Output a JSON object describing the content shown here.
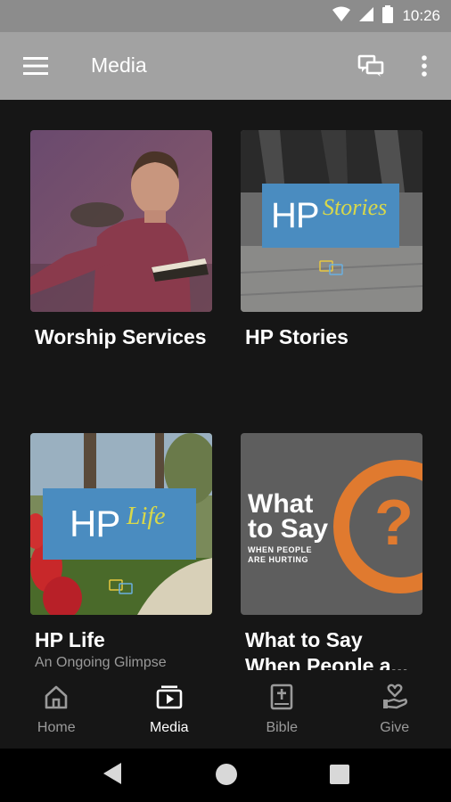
{
  "status_bar": {
    "time": "10:26"
  },
  "app_bar": {
    "title": "Media"
  },
  "cards": [
    {
      "title": "Worship Services"
    },
    {
      "title": "HP Stories",
      "logo_text": "HP",
      "logo_script": "Stories"
    },
    {
      "title": "HP Life",
      "subtitle": "An Ongoing Glimpse",
      "logo_text": "HP",
      "logo_script": "Life"
    },
    {
      "title": "What to Say When People a...",
      "line1": "What",
      "line2": "to Say",
      "line3": "WHEN PEOPLE",
      "line4": "ARE HURTING"
    }
  ],
  "bottom_nav": [
    {
      "label": "Home",
      "icon": "home-icon"
    },
    {
      "label": "Media",
      "icon": "media-icon"
    },
    {
      "label": "Bible",
      "icon": "bible-icon"
    },
    {
      "label": "Give",
      "icon": "give-icon"
    }
  ],
  "colors": {
    "accent_blue": "#4a8cc0",
    "orange": "#e07a2f",
    "status_bar": "#8c8c8c",
    "app_bar": "#a2a2a2"
  }
}
